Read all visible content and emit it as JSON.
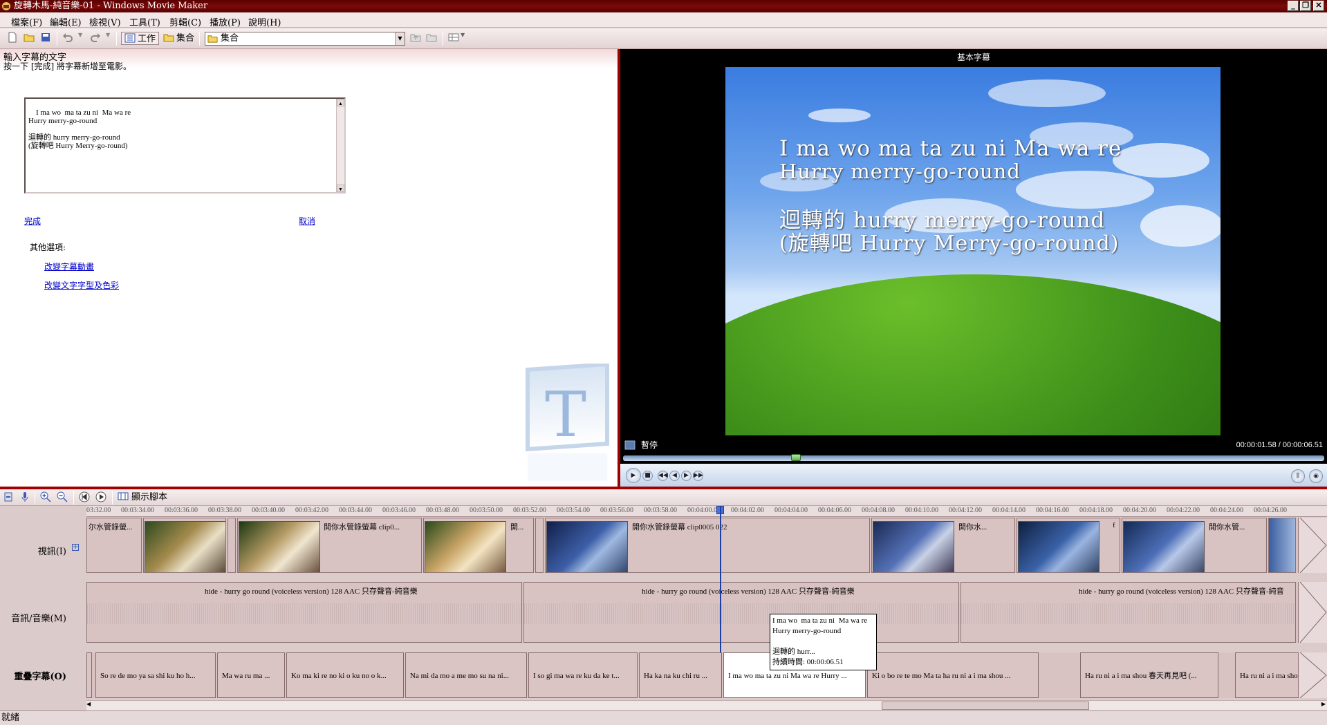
{
  "window": {
    "title": "旋轉木馬-純音樂-01 - Windows Movie Maker"
  },
  "menu": [
    "檔案(F)",
    "編輯(E)",
    "檢視(V)",
    "工具(T)",
    "剪輯(C)",
    "播放(P)",
    "說明(H)"
  ],
  "toolbar": {
    "tasks_label": "工作",
    "collections_label": "集合",
    "collection_value": "集合"
  },
  "taskpane": {
    "heading": "輸入字幕的文字",
    "instruction": "按一下 [完成] 將字幕新增至電影。",
    "title_text": "I ma wo  ma ta zu ni  Ma wa re\nHurry merry-go-round\n\n迴轉的 hurry merry-go-round\n(旋轉吧 Hurry Merry-go-round)",
    "done_link": "完成",
    "cancel_link": "取消",
    "other_options": "其他選項:",
    "change_animation_link": "改變字幕動畫",
    "change_font_link": "改變文字字型及色彩"
  },
  "preview": {
    "title": "基本字幕",
    "subtitle_lines": [
      "I ma wo  ma ta zu ni  Ma wa re",
      "Hurry merry-go-round",
      "迴轉的 hurry merry-go-round",
      "(旋轉吧 Hurry Merry-go-round)"
    ],
    "status": "暫停",
    "time": "00:00:01.58 / 00:00:06.51",
    "seek_position": 0.243
  },
  "timeline_toolbar": {
    "show_storyboard": "顯示腳本"
  },
  "timeline": {
    "ruler_ticks": [
      "03:32.00",
      "00:03:34.00",
      "00:03:36.00",
      "00:03:38.00",
      "00:03:40.00",
      "00:03:42.00",
      "00:03:44.00",
      "00:03:46.00",
      "00:03:48.00",
      "00:03:50.00",
      "00:03:52.00",
      "00:03:54.00",
      "00:03:56.00",
      "00:03:58.00",
      "00:04:00.00",
      "00:04:02.00",
      "00:04:04.00",
      "00:04:06.00",
      "00:04:08.00",
      "00:04:10.00",
      "00:04:12.00",
      "00:04:14.00",
      "00:04:16.00",
      "00:04:18.00",
      "00:04:20.00",
      "00:04:22.00",
      "00:04:24.00",
      "00:04:26.00"
    ],
    "tracks": {
      "video_label": "視訊(I)",
      "audio_label": "音訊/音樂(M)",
      "overlay_label": "重疊字幕(O)"
    },
    "video_clips": [
      "尔水管錄螢...",
      "",
      "",
      "開你水管錄螢幕 clip0...",
      "",
      "開...",
      "",
      "開你水管錄螢幕 clip0005 022",
      "",
      "開你水...",
      "",
      "f",
      "開你水管..."
    ],
    "audio_clips": [
      "hide - hurry go round (voiceless version) 128 AAC 只存聲音-純音樂",
      "hide - hurry go round (voiceless version) 128 AAC 只存聲音-純音樂",
      "hide - hurry go round (voiceless version) 128 AAC 只存聲音-純音"
    ],
    "title_clips": [
      "So re de mo  ya sa shi ku  ho h...",
      "Ma wa ru  ma ...",
      "Ko ma ki re no   ki o ku no o k...",
      "Na mi da mo  a me mo  su na ni...",
      "I so gi  ma wa re  ku da ke t...",
      "Ha ka na ku  chi ru ...",
      "I ma wo  ma ta zu ni  Ma wa re Hurry ...",
      "Ki o bo re te mo Ma ta  ha ru ni  a i ma shou  ...",
      "Ha ru ni  a i ma shou  春天再見吧 (...",
      "Ha ru ni  a i ma sho"
    ],
    "tooltip": "I ma wo  ma ta zu ni  Ma wa re\nHurry merry-go-round\n\n迴轉的 hurr...\n持續時間: 00:00:06.51"
  },
  "statusbar": {
    "text": "就緒"
  }
}
